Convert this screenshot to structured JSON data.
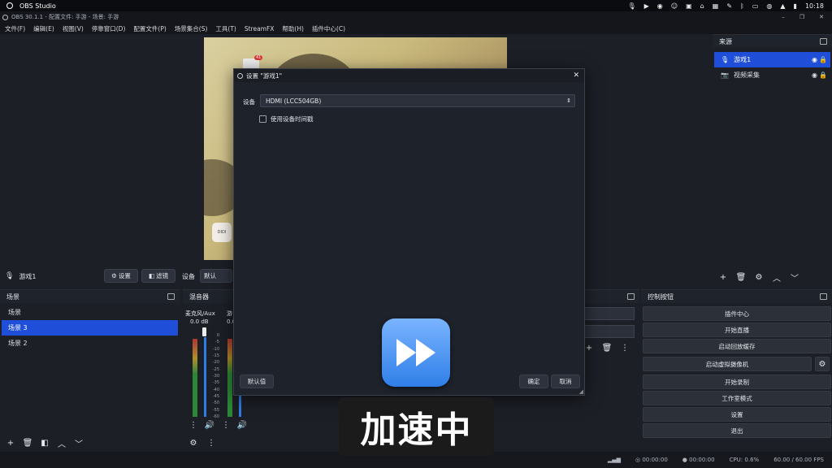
{
  "system_bar": {
    "app_name": "OBS Studio",
    "time": "10:18"
  },
  "window": {
    "title": "OBS 30.1.1 - 配置文件: 手游 - 场景: 手游"
  },
  "menu": [
    "文件(F)",
    "编辑(E)",
    "视图(V)",
    "停靠窗口(D)",
    "配置文件(P)",
    "场景集合(S)",
    "工具(T)",
    "StreamFX",
    "帮助(H)",
    "插件中心(C)"
  ],
  "canvas": {
    "badge_count": "41",
    "app_label": "DIDI"
  },
  "source_bar": {
    "source_name": "游戏1",
    "settings_label": "设置",
    "filters_label": "滤镜",
    "device_label": "设备",
    "device_value": "默认"
  },
  "sources": {
    "title": "来源",
    "items": [
      {
        "label": "游戏1",
        "icon": "mic-icon",
        "selected": true
      },
      {
        "label": "视频采集",
        "icon": "camera-icon",
        "selected": false
      }
    ]
  },
  "scenes": {
    "title": "场景",
    "items": [
      "场景",
      "场景 3",
      "场景 2"
    ],
    "selected_index": 1
  },
  "mixer": {
    "title": "混音器",
    "channel_name": "麦克风/Aux",
    "channel2_partial": "游",
    "db_value": "0.0 dB",
    "db_value2": "0.0",
    "scale": [
      "0",
      "-5",
      "-10",
      "-15",
      "-20",
      "-25",
      "-30",
      "-35",
      "-40",
      "-45",
      "-50",
      "-55",
      "-60"
    ]
  },
  "controls": {
    "title": "控制按钮",
    "buttons": [
      "插件中心",
      "开始直播",
      "启动回放缓存",
      "启动虚拟摄像机",
      "开始录制",
      "工作室模式",
      "设置",
      "退出"
    ]
  },
  "status": {
    "stream_time": "00:00:00",
    "record_time": "00:00:00",
    "cpu": "CPU: 0.6%",
    "fps": "60.00 / 60.00 FPS"
  },
  "dialog": {
    "title": "设置 \"游戏1\"",
    "device_label": "设备",
    "device_value": "HDMI (LCC504GB)",
    "checkbox_label": "使用设备时间戳",
    "defaults_label": "默认值",
    "ok_label": "确定",
    "cancel_label": "取消"
  },
  "overlay": {
    "caption": "加速中"
  },
  "colors": {
    "accent": "#1f4fd8",
    "panel": "#1c1f26",
    "overlay_button": "#3b8bf0"
  }
}
